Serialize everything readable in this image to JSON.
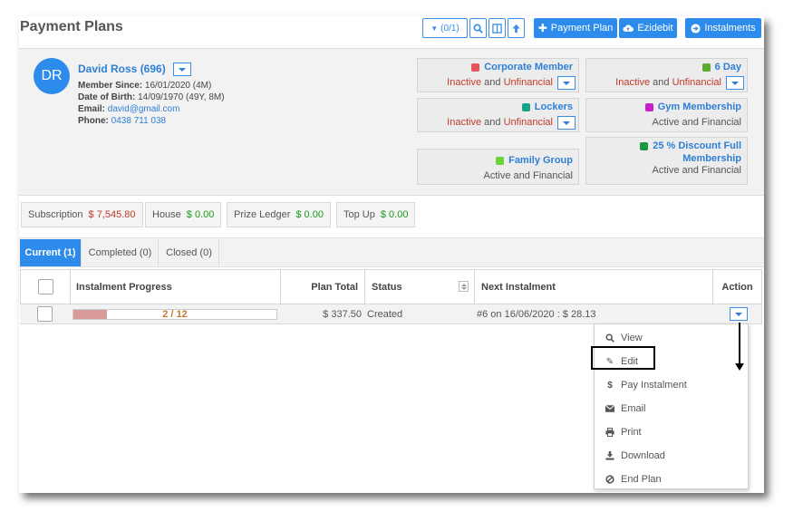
{
  "page": {
    "title": "Payment Plans"
  },
  "toolbar": {
    "filter_label": "(0/1)",
    "payment_plan_label": "Payment Plan",
    "ezidebit_label": "Ezidebit",
    "instalments_label": "Instalments"
  },
  "member": {
    "initials": "DR",
    "name": "David Ross (696)",
    "since_label": "Member Since:",
    "since_value": "16/01/2020 (4M)",
    "dob_label": "Date of Birth:",
    "dob_value": "14/09/1970 (49Y, 8M)",
    "email_label": "Email:",
    "email_value": "david@gmail.com",
    "phone_label": "Phone:",
    "phone_value": "0438 711 038"
  },
  "tags": [
    {
      "title": "Corporate Member",
      "swatch": "#e8505b",
      "status_a": "Inactive",
      "and": "and",
      "status_b": "Unfinancial",
      "red": true,
      "dropdown": true
    },
    {
      "title": "6 Day",
      "swatch": "#5bab2f",
      "status_a": "Inactive",
      "and": "and",
      "status_b": "Unfinancial",
      "red": true,
      "dropdown": true
    },
    {
      "title": "Lockers",
      "swatch": "#17a589",
      "status_a": "Inactive",
      "and": "and",
      "status_b": "Unfinancial",
      "red": true,
      "dropdown": true
    },
    {
      "title": "Gym Membership",
      "swatch": "#c61fc9",
      "status_a": "Active",
      "and": "and",
      "status_b": "Financial",
      "red": false,
      "dropdown": false
    },
    {
      "title": "Family Group",
      "swatch": "#6ad33c",
      "status_a": "Active",
      "and": "and",
      "status_b": "Financial",
      "red": false,
      "dropdown": false
    },
    {
      "title_line1": "25 % Discount Full",
      "title_line2": "Membership",
      "swatch": "#1a9a3e",
      "status_a": "Active",
      "and": "and",
      "status_b": "Financial",
      "red": false,
      "dropdown": false
    }
  ],
  "balances": [
    {
      "label": "Subscription",
      "value": "$ 7,545.80",
      "tone": "neg"
    },
    {
      "label": "House",
      "value": "$ 0.00",
      "tone": "pos"
    },
    {
      "label": "Prize Ledger",
      "value": "$ 0.00",
      "tone": "pos"
    },
    {
      "label": "Top Up",
      "value": "$ 0.00",
      "tone": "pos"
    }
  ],
  "tabs": [
    {
      "label": "Current (1)",
      "active": true
    },
    {
      "label": "Completed (0)",
      "active": false
    },
    {
      "label": "Closed (0)",
      "active": false
    }
  ],
  "table": {
    "headers": {
      "progress": "Instalment Progress",
      "total": "Plan Total",
      "status": "Status",
      "next": "Next Instalment",
      "action": "Action"
    },
    "rows": [
      {
        "progress_text": "2 / 12",
        "progress_fraction": 0.167,
        "total": "$ 337.50",
        "status": "Created",
        "next": "#6 on 16/06/2020 : $ 28.13"
      }
    ]
  },
  "action_menu": {
    "items": [
      {
        "label": "View",
        "icon": "search-icon",
        "glyph": "🔍"
      },
      {
        "label": "Edit",
        "icon": "pencil-icon",
        "glyph": "✎"
      },
      {
        "label": "Pay Instalment",
        "icon": "dollar-icon",
        "glyph": "$"
      },
      {
        "label": "Email",
        "icon": "envelope-icon",
        "glyph": "✉"
      },
      {
        "label": "Print",
        "icon": "printer-icon",
        "glyph": "⎙"
      },
      {
        "label": "Download",
        "icon": "download-icon",
        "glyph": "⤓"
      },
      {
        "label": "End Plan",
        "icon": "ban-icon",
        "glyph": "⊘"
      }
    ],
    "highlighted": "Edit"
  },
  "colors": {
    "accent": "#2d8ceb",
    "negative": "#c03a2b",
    "positive": "#1a9a1a"
  }
}
